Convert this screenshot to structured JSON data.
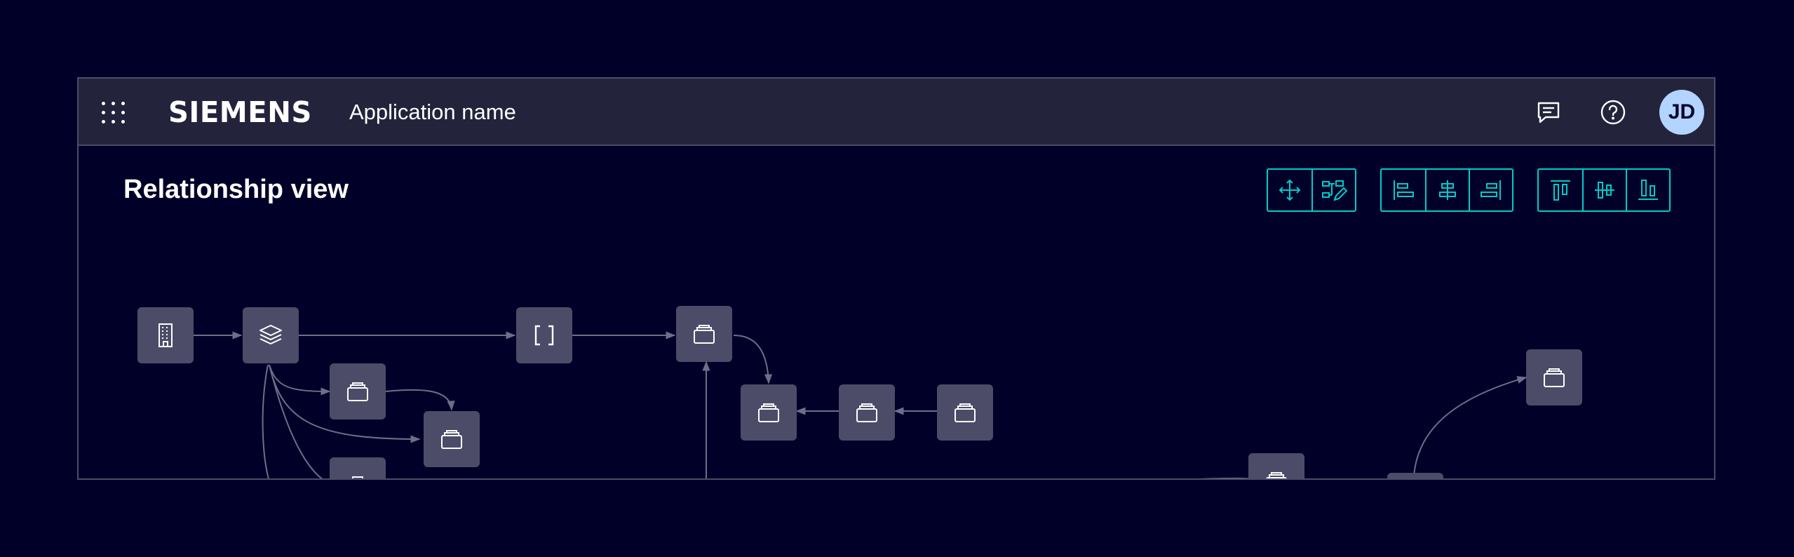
{
  "header": {
    "brand": "SIEMENS",
    "app_name": "Application name",
    "user_initials": "JD",
    "icons": {
      "launcher": "app-launcher-icon",
      "messages": "chat-icon",
      "help": "help-icon"
    }
  },
  "page": {
    "title": "Relationship view"
  },
  "toolbar": {
    "groups": [
      [
        "fit-to-screen-icon",
        "auto-layout-edit-icon"
      ],
      [
        "align-left-icon",
        "align-center-icon",
        "align-right-icon"
      ],
      [
        "align-top-icon",
        "align-middle-icon",
        "align-bottom-icon"
      ]
    ]
  },
  "graph": {
    "node_icons": [
      "building-icon",
      "layers-icon",
      "bracket-icon",
      "box-icon"
    ]
  },
  "colors": {
    "background": "#000028",
    "header": "#23233c",
    "node": "#4c4c68",
    "edge": "#6e6e8a",
    "accent": "#00cccc",
    "avatar": "#b3d4ff"
  }
}
